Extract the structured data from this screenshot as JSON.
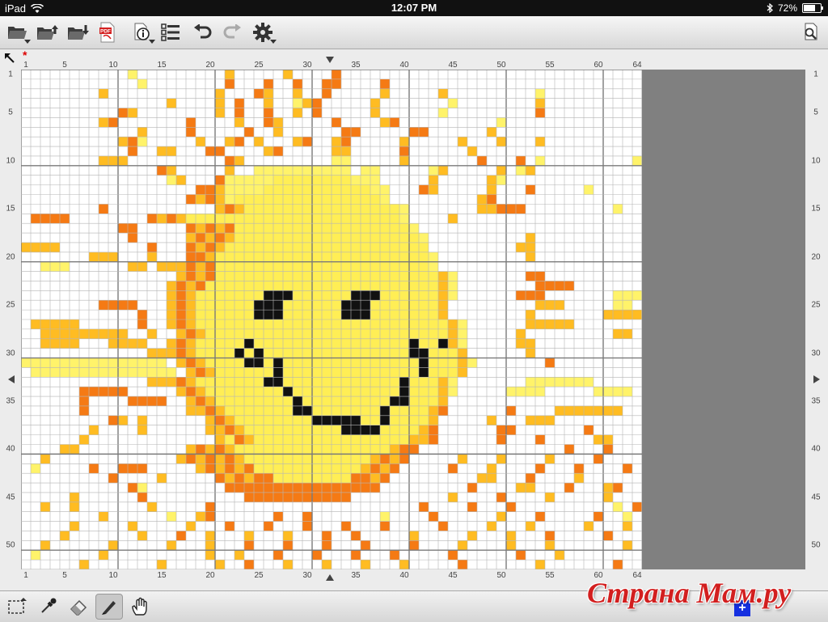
{
  "status_bar": {
    "device": "iPad",
    "time": "12:07 PM",
    "battery": "72%",
    "battery_level": 0.72
  },
  "toolbar": {
    "left_icons": [
      "folder-open-icon",
      "folder-export-icon",
      "folder-import-icon",
      "pdf-icon",
      "info-icon",
      "list-icon",
      "undo-icon",
      "redo-icon",
      "gear-icon"
    ],
    "right_icons": [
      "page-preview-icon"
    ],
    "pdf_label": "PDF"
  },
  "modified_mark": "*",
  "grid": {
    "columns": 64,
    "rows": 52,
    "top_ruler_labels": [
      1,
      5,
      10,
      15,
      20,
      25,
      30,
      35,
      40,
      45,
      50,
      55,
      60,
      64
    ],
    "bottom_ruler_labels": [
      1,
      5,
      10,
      15,
      20,
      25,
      30,
      35,
      40,
      45,
      50,
      55,
      60,
      64
    ],
    "side_ruler_labels": [
      1,
      5,
      10,
      15,
      20,
      25,
      30,
      35,
      40,
      45,
      50
    ],
    "colors": {
      "Y": "#ffee55",
      "O": "#f57a14",
      "A": "#ffbc22",
      "L": "#fff36a",
      "K": "#111111",
      "grid": "#b5b5b5",
      "grid_major": "#7a7a7a",
      "background": "#ffffff"
    },
    "pattern": [
      "...........L.........A.....A....O...............................",
      "............L........O...O..O..OO....O..........................",
      "........A...........A...OA..A..O.....A.....A.........L..........",
      "...............A....A.O..A..LAO.....A.......L........A..........",
      "..........OA........A.O..O..A.O.....A......L.........O..........",
      "........AO.......O....A..OA.....O....AO..........L...............",
      "............A....O.....O..A......OO.....OO......A................",
      "..........AOL.....A..AO.A...AO..AO.....A.....A...A...A...........",
      "...........O..AA...OO....AO.....AA.....O......A..................",
      "........AAA..........OA.........LL.....A.......O...O.L.........L.",
      "..............OA.....A..LLLLLLLLLL.LL.....LA.....A.LA...........",
      "...............LA...OLLLLLYYYYYYYYLLL.....A.....AL...............",
      "..................OOALLLLYYYYYYYYYYYLL...OA.....A...O.....L......",
      ".................OAOALYYYYYYYYYYYYYYYL.........AO...............",
      "........O...........AOAYYYYYYYYYYYYYYYYL.......AAOOO.........L...",
      ".OOOO........OAOAYYYYYYYYYYYYYYYYYYYYYYL....A.....................",
      "..........OO.....OAOAOYYYYYYYYYYYYYYYYYYL........................",
      "...........O.....AOAOAYYYYYYYYYYYYYYYYYYYL..........A.............",
      "AAAA.........O...OAOAYYYYYYYYYYYYYYYYYYYYY.........AA.............",
      ".......AAA...A...OOAYYYYYYYYYYYYYYYYYYYYYYL.........A.............",
      "..LLL......AA.AAAOAOYYYYYYYYYYYYYYYYYYYYYYL.......................",
      "................AOAOYYYYYYYYYYYYYYYYYYYYYYYAL.......OO.............",
      "...............AOAOYYYYYYYYYYYYYYYYYYYYYYYYAL........OOOO........A.",
      "...............AOAYYYYYYYKKKYYYYYYKKKYYYYYYAL......OOO.......LLLL..",
      "........OOOO...AOAYYYYYYKKKYYYYYYKKKYYYYYYYA.........AAA.....LL...",
      "............O..AOAYYYYYYKKKYYYYYYKKKYYYYYYYA........A.......AAAA..",
      ".AAAAA......O..AOAYYYYYYYYYYYYYYYYYYYYYYYYYYAL......AAAAA.........",
      "..AAAAAAAAA..A..AOAYYYYYYYYYYYYYYYYYYYYYYYYYAL.....A.........AA....",
      "..AAAA...AAAA..AOAYYYYYKYYYYYYYYYYYYYYYYKYYKAL.....AA..............",
      ".............AAAOAYYYYKYKYYYYYYYYYYYYYYYKKYYYA......A..............",
      "LLLLLLLLLLLLLLL.AOAYYYYKKYKYYYYYYYYYYYYYYKYYYAL.......O............",
      ".LLLLLLLLLLLLLLL.AOAYYYYYYKYYYYYYYYYYYYYYKYYYA..................L",
      ".............AAAOAYYYYYYYKKYYYYYYYYYYYYKYYYAL.......LLLLLLL......",
      "......OOOOO.....AOAYYYYYYYYKYYYYYYYYYYYKYYYAL.....LLLL.....LLLL...",
      "......O....OOOO..AOAYYYYYYYYKYYYYYYYYYKKYYYA.......................",
      "......O..........AAOAYYYYYYYKKYYYYYYYKYYYYAO......O....AAAAAAA....",
      ".........OA.A......AOAYYYYYYYYKKKKKYYKYYYYA.....A...AAA...........",
      ".......A....A......AAOAYYYYYYYYYYKKKKYYYYAO......OO.......O........",
      "......A.............AYOAYYYYYYYYYYYYYYYYAAO......O...O.....AA......",
      "....AA...........AOAOAYYYYYYYYYYYYYYYYAOO...............O...O.....",
      "..A.............AOAOAOAYYYYYYYYYYYYYAOAO.....A...A....A....O.......",
      ".L.....O..OOO.....AOAOAOYYYYYYYYYYYAOAO.....O...A....O...O....O....",
      ".........O....A.....OAOAOOYYYYYYYYOOAO.........AA...O....A.........",
      "...........OL........OOOOOOOOOOOOOOOO.........O....AA...O...AO.....",
      ".....A......O..........OOOOOOOOOOO..........A....O....A.....A......",
      "..A..A.......A.....O.....................O....O...O..........L.O...",
      "........A......L..AO......O..O.......L....O......A...O.....O..L....",
      ".....A.....A.....A...O...O...O...O...O.....O....A...A.....A...A....",
      "....A.......A...O..A...A...A...O..O.....A.....A...A...O.....O......",
      "..A......A.....A...A...O...O...O...O....O....A....A...A.......A....",
      ".L......A..........A..A...O...O...O...O.....O......O...A........A..",
      "......A.......A.....A..O...A...A...A...A.....O.......A.......O....."
    ]
  },
  "bottom_tools": [
    "selection-icon",
    "eyedropper-icon",
    "eraser-icon",
    "pencil-icon",
    "hand-icon"
  ],
  "active_tool": "pencil-icon",
  "add_button": "+",
  "watermark": "Страна Мам.ру"
}
